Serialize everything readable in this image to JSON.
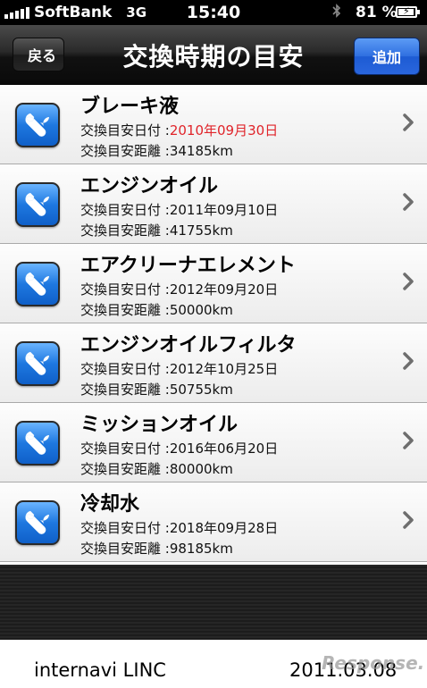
{
  "status_bar": {
    "carrier": "SoftBank",
    "network": "3G",
    "time": "15:40",
    "battery_percent": "81 %",
    "icons": [
      "signal-bars-icon",
      "bluetooth-icon",
      "battery-charging-icon"
    ]
  },
  "nav": {
    "back_label": "戻る",
    "title": "交換時期の目安",
    "add_label": "追加"
  },
  "items": [
    {
      "name": "ブレーキ液",
      "date_label": "交換目安日付",
      "date": "2010年09月30日",
      "date_overdue": true,
      "distance_label": "交換目安距離",
      "distance": "34185km"
    },
    {
      "name": "エンジンオイル",
      "date_label": "交換目安日付",
      "date": "2011年09月10日",
      "date_overdue": false,
      "distance_label": "交換目安距離",
      "distance": "41755km"
    },
    {
      "name": "エアクリーナエレメント",
      "date_label": "交換目安日付",
      "date": "2012年09月20日",
      "date_overdue": false,
      "distance_label": "交換目安距離",
      "distance": "50000km"
    },
    {
      "name": "エンジンオイルフィルタ",
      "date_label": "交換目安日付",
      "date": "2012年10月25日",
      "date_overdue": false,
      "distance_label": "交換目安距離",
      "distance": "50755km"
    },
    {
      "name": "ミッションオイル",
      "date_label": "交換目安日付",
      "date": "2016年06月20日",
      "date_overdue": false,
      "distance_label": "交換目安距離",
      "distance": "80000km"
    },
    {
      "name": "冷却水",
      "date_label": "交換目安日付",
      "date": "2018年09月28日",
      "date_overdue": false,
      "distance_label": "交換目安距離",
      "distance": "98185km"
    }
  ],
  "colors": {
    "overdue": "#e0242a",
    "add_button": "#2f6fe0",
    "icon_blue": "#1e78e0"
  },
  "caption": {
    "left": "internavi LINC",
    "right": "2011.03.08",
    "watermark": "Response."
  }
}
